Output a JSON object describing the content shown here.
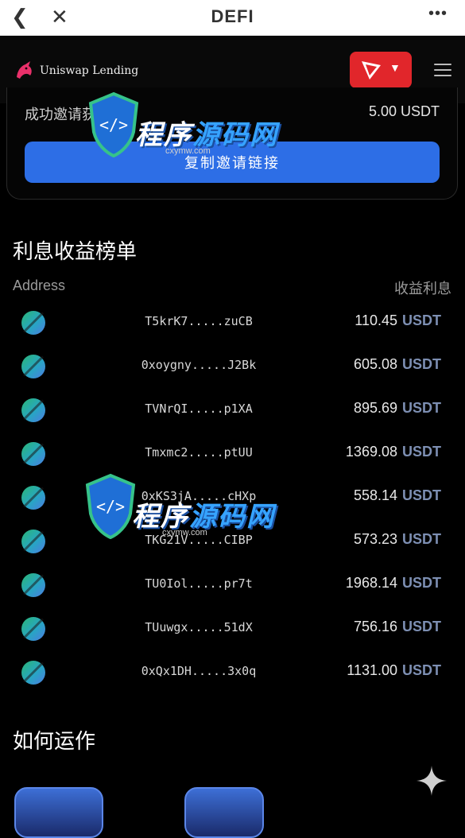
{
  "browser": {
    "title": "DEFI",
    "back_icon": "chevron-left-icon",
    "close_icon": "close-icon",
    "more_icon": "more-dots-icon"
  },
  "header": {
    "brand": "Uniswap Lending",
    "chain_icon": "tron-icon",
    "menu_icon": "hamburger-menu-icon"
  },
  "invite": {
    "label": "成功邀请获得",
    "value": "5.00 USDT",
    "button": "复制邀请链接"
  },
  "leaderboard": {
    "title": "利息收益榜单",
    "col_address": "Address",
    "col_earnings": "收益利息",
    "rows": [
      {
        "address": "T5krK7.....zuCB",
        "amount": "110.45",
        "unit": "USDT"
      },
      {
        "address": "0xoygny.....J2Bk",
        "amount": "605.08",
        "unit": "USDT"
      },
      {
        "address": "TVNrQI.....p1XA",
        "amount": "895.69",
        "unit": "USDT"
      },
      {
        "address": "Tmxmc2.....ptUU",
        "amount": "1369.08",
        "unit": "USDT"
      },
      {
        "address": "0xKS3jA.....cHXp",
        "amount": "558.14",
        "unit": "USDT"
      },
      {
        "address": "TKG21V.....CIBP",
        "amount": "573.23",
        "unit": "USDT"
      },
      {
        "address": "TU0Iol.....pr7t",
        "amount": "1968.14",
        "unit": "USDT"
      },
      {
        "address": "TUuwgx.....51dX",
        "amount": "756.16",
        "unit": "USDT"
      },
      {
        "address": "0xQx1DH.....3x0q",
        "amount": "1131.00",
        "unit": "USDT"
      }
    ]
  },
  "how": {
    "title": "如何运作"
  },
  "watermark": {
    "text_a": "程序",
    "text_b": "源码网",
    "url": "cxymw.com"
  },
  "colors": {
    "accent": "#2d6ee6",
    "chain": "#e1262b",
    "unit": "#7d8fb3"
  }
}
